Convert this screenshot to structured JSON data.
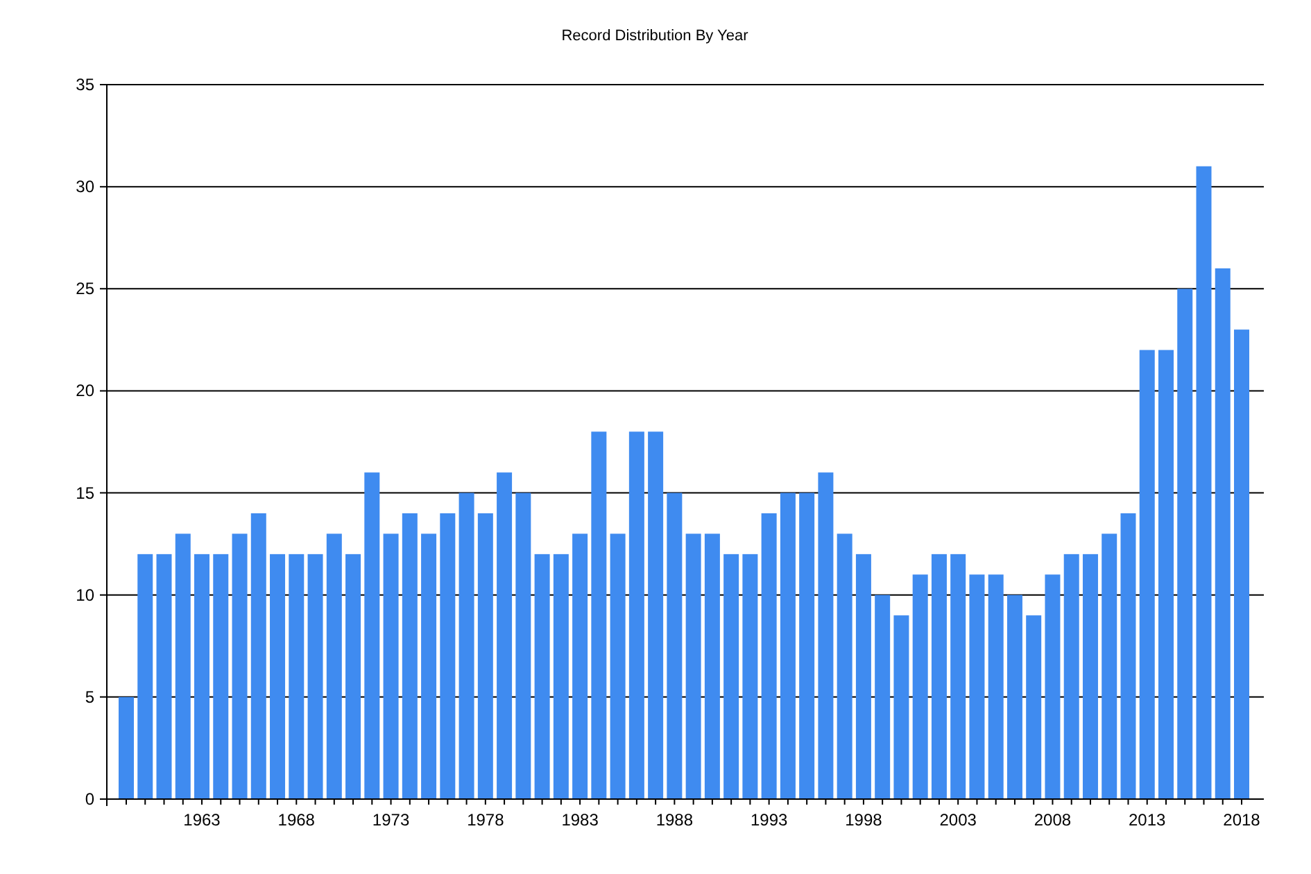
{
  "chart_data": {
    "type": "bar",
    "title": "Record Distribution By Year",
    "categories": [
      null,
      null,
      null,
      null,
      "1963",
      null,
      null,
      null,
      null,
      "1968",
      null,
      null,
      null,
      null,
      "1973",
      null,
      null,
      null,
      null,
      "1978",
      null,
      null,
      null,
      null,
      "1983",
      null,
      null,
      null,
      null,
      "1988",
      null,
      null,
      null,
      null,
      "1993",
      null,
      null,
      null,
      null,
      "1998",
      null,
      null,
      null,
      null,
      "2003",
      null,
      null,
      null,
      null,
      "2008",
      null,
      null,
      null,
      null,
      "2013",
      null,
      null,
      null,
      null,
      "2018"
    ],
    "series": [
      {
        "color": "#3f8bf0",
        "values": [
          5,
          12,
          12,
          13,
          12,
          12,
          13,
          14,
          12,
          12,
          12,
          13,
          12,
          16,
          13,
          14,
          13,
          14,
          15,
          14,
          16,
          15,
          12,
          12,
          13,
          18,
          13,
          18,
          18,
          15,
          13,
          13,
          12,
          12,
          14,
          15,
          15,
          16,
          13,
          12,
          10,
          9,
          11,
          12,
          12,
          11,
          11,
          10,
          9,
          11,
          12,
          12,
          13,
          14,
          22,
          22,
          25,
          31,
          26,
          23
        ]
      }
    ],
    "ylim": [
      0,
      35
    ],
    "yticks": [
      0,
      5,
      10,
      15,
      20,
      25,
      30,
      35
    ],
    "grid": true
  }
}
